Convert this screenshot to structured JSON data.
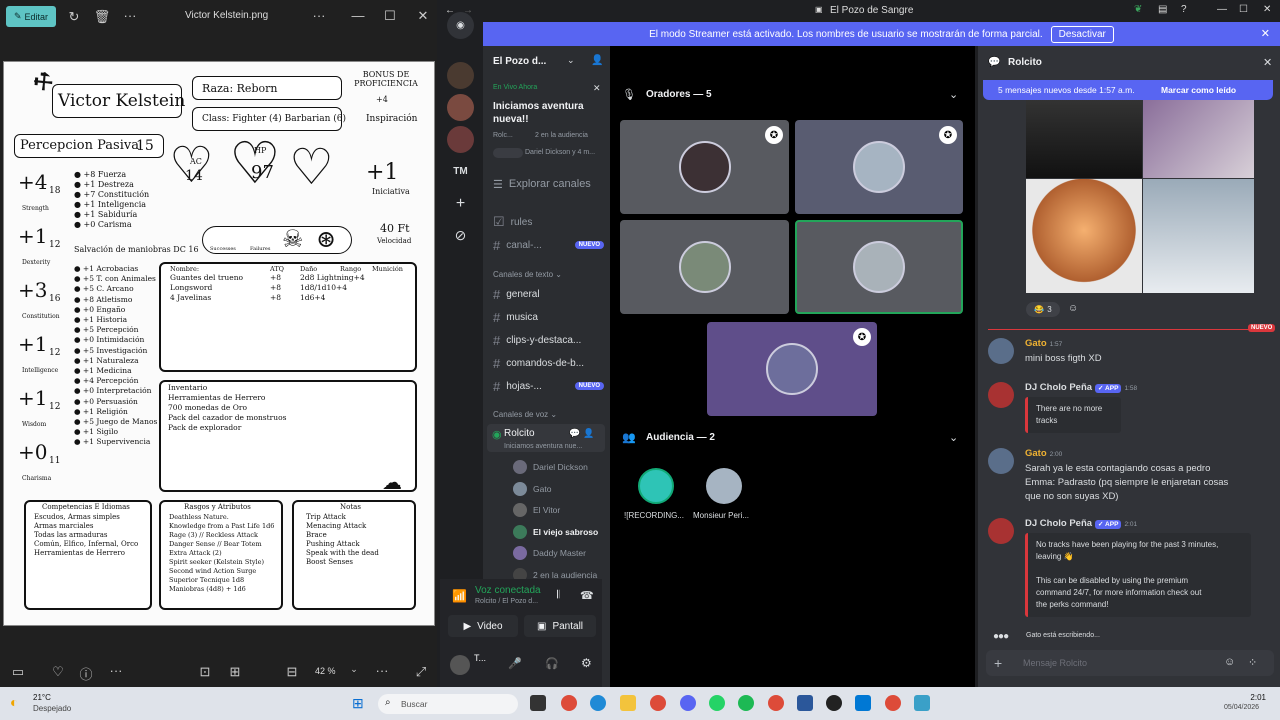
{
  "viewer": {
    "edit_label": "Editar",
    "file_title": "Victor Kelstein.png",
    "zoom": "42 %",
    "sheet": {
      "name": "Victor Kelstein",
      "race": "Raza: Reborn",
      "class": "Class: Fighter (4) Barbarian (6)",
      "prof_label": "BONUS DE PROFICIENCIA",
      "prof_value": "+4",
      "inspiration": "Inspiración",
      "passive": "Percepcion Pasiva",
      "passive_value": "15",
      "ac_label": "AC",
      "ac_value": "14",
      "hp_label": "HP",
      "hp_value": "97",
      "init_value": "+1",
      "init_label": "Iniciativa",
      "speed_value": "40 Ft",
      "speed_label": "Velocidad",
      "save_dc": "Salvación de maniobras DC 16",
      "successes": "Successes",
      "failures": "Failures",
      "abilities": [
        {
          "mod": "+4",
          "score": "18",
          "label": "Strength"
        },
        {
          "mod": "+1",
          "score": "12",
          "label": "Dexterity"
        },
        {
          "mod": "+3",
          "score": "16",
          "label": "Constitution"
        },
        {
          "mod": "+1",
          "score": "12",
          "label": "Intelligence"
        },
        {
          "mod": "+1",
          "score": "12",
          "label": "Wisdom"
        },
        {
          "mod": "+0",
          "score": "11",
          "label": "Charisma"
        }
      ],
      "saves": [
        "+8 Fuerza",
        "+1 Destreza",
        "+7 Constitución",
        "+1 Inteligencia",
        "+1 Sabiduría",
        "+0 Carisma"
      ],
      "skills": [
        "+1 Acrobacias",
        "+5 T. con Animales",
        "+5 C. Arcano",
        "+8 Atletismo",
        "+0 Engaño",
        "+1 Historia",
        "+5 Percepción",
        "+0 Intimidación",
        "+5 Investigación",
        "+1 Naturaleza",
        "+1 Medicina",
        "+4 Percepción",
        "+0 Interpretación",
        "+0 Persuasión",
        "+1 Religión",
        "+5 Juego de Manos",
        "+1 Sigilo",
        "+1 Supervivencia"
      ],
      "attacks_head": [
        "Nombre:",
        "ATQ",
        "Daño",
        "Rango",
        "Munición"
      ],
      "attacks": [
        [
          "Guantes del trueno",
          "+8",
          "2d8 Lightning+4"
        ],
        [
          "Longsword",
          "+8",
          "1d8/1d10+4"
        ],
        [
          "4 Javelinas",
          "+8",
          "1d6+4"
        ]
      ],
      "inventory": [
        "Inventario",
        "Herramientas de Herrero",
        "700 monedas de Oro",
        "Pack del cazador de monstruos",
        "Pack de explorador"
      ],
      "comp_title": "Competencias E Idiomas",
      "comp": [
        "Escudos, Armas simples",
        "Armas marciales",
        "Todas las armaduras",
        "Común, Elfico, Infernal, Orco",
        "Herramientas de Herrero"
      ],
      "traits_title": "Rasgos y Atributos",
      "traits": [
        "Deathless Nature.",
        "Knowledge from a Past Life  1d6",
        "Rage (3) // Reckless Attack",
        "Danger Sense // Bear Totem",
        "Extra Attack (2)",
        "Spirit seeker (Kelstein Style)",
        "Second wind     Action Surge",
        "Superior Tecnique 1d8",
        "Maniobras (4d8) + 1d6"
      ],
      "notes_title": "Notas",
      "notes": [
        "Trip Attack",
        "Menacing Attack",
        "Brace",
        "Pushing Attack",
        "Speak with the dead",
        "Boost Senses"
      ]
    }
  },
  "discord": {
    "window_title": "El Pozo de Sangre",
    "streamer_banner": "El modo Streamer está activado. Los nombres de usuario se mostrarán de forma parcial.",
    "streamer_button": "Desactivar",
    "server_name": "El Pozo d...",
    "live_label": "En Vivo Ahora",
    "live_title": "Iniciamos aventura nueva!!",
    "live_sub1": "Rolc...",
    "live_sub2": "2 en la audiencia",
    "live_sub3": "Dariel Dickson y 4 m...",
    "tm": "TM",
    "explore": "Explorar canales",
    "channels_top": [
      {
        "name": "rules",
        "badge": ""
      },
      {
        "name": "canal-...",
        "badge": "NUEVO"
      }
    ],
    "text_section": "Canales de texto",
    "text_channels": [
      {
        "name": "general",
        "badge": ""
      },
      {
        "name": "musica",
        "badge": ""
      },
      {
        "name": "clips-y-destaca...",
        "badge": ""
      },
      {
        "name": "comandos-de-b...",
        "badge": ""
      },
      {
        "name": "hojas-...",
        "badge": "NUEVO"
      }
    ],
    "voice_section": "Canales de voz",
    "voice_channel": "Rolcito",
    "voice_channel_sub": "Iniciamos aventura nue...",
    "voice_members": [
      "Dariel Dickson",
      "Gato",
      "El Vitor",
      "El viejo sabroso",
      "Daddy Master",
      "2 en la audiencia"
    ],
    "voice_connected": "Voz conectada",
    "voice_location": "Rolcito / El Pozo d...",
    "video_btn": "Video",
    "screen_btn": "Pantall",
    "user_short": "T...",
    "speakers_label": "Oradores — 5",
    "audience_label": "Audiencia — 2",
    "audience": [
      "![RECORDING...",
      "Monsieur Peri..."
    ],
    "chat": {
      "channel": "Rolcito",
      "new_banner": "5 mensajes nuevos desde 1:57 a.m.",
      "mark_read": "Marcar como leído",
      "reaction_count": "3",
      "new_divider": "NUEVO",
      "messages": [
        {
          "author": "Gato",
          "time": "1:57",
          "color": "#f0b232",
          "lines": [
            "mini boss figth XD"
          ]
        },
        {
          "author": "DJ Cholo Peña",
          "app": "APP",
          "time": "1:58",
          "color": "#dbdee1",
          "embed": [
            "There are no more tracks"
          ]
        },
        {
          "author": "Gato",
          "time": "2:00",
          "color": "#f0b232",
          "lines": [
            "Sarah ya le esta contagiando cosas a pedro",
            "Emma: Padrasto (pq siempre le enjaretan cosas",
            "que no son suyas XD)"
          ]
        },
        {
          "author": "DJ Cholo Peña",
          "app": "APP",
          "time": "2:01",
          "color": "#dbdee1",
          "embed": [
            "No tracks have been playing for the past 3 minutes,",
            "leaving 👋",
            "",
            "This can be disabled by using the premium",
            "command 24/7, for more information check out",
            "the perks command!"
          ]
        }
      ],
      "typing": "Gato está escribiendo...",
      "input_placeholder": "Mensaje Rolcito"
    }
  },
  "taskbar": {
    "weather_temp": "21°C",
    "weather_desc": "Despejado",
    "search_placeholder": "Buscar",
    "time": "2:01",
    "date": "05/04/2026"
  }
}
